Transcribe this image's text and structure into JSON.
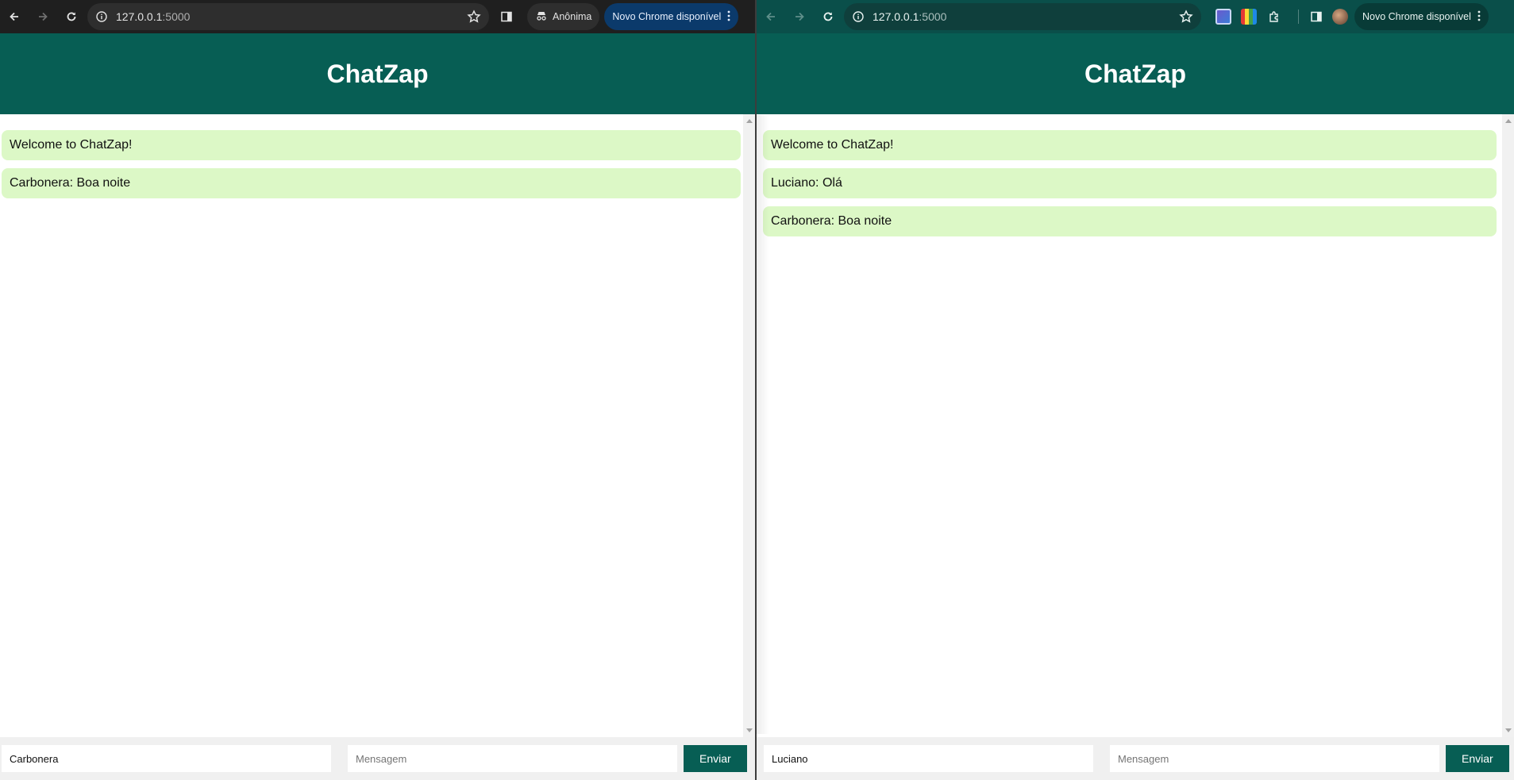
{
  "left": {
    "browser": {
      "url_host": "127.0.0.1",
      "url_port": ":5000",
      "incognito_label": "Anônima",
      "update_label": "Novo Chrome disponível"
    },
    "app": {
      "title": "ChatZap",
      "messages": [
        "Welcome to ChatZap!",
        "Carbonera: Boa noite"
      ],
      "username_value": "Carbonera",
      "message_placeholder": "Mensagem",
      "send_label": "Enviar"
    }
  },
  "right": {
    "browser": {
      "url_host": "127.0.0.1",
      "url_port": ":5000",
      "update_label": "Novo Chrome disponível"
    },
    "app": {
      "title": "ChatZap",
      "messages": [
        "Welcome to ChatZap!",
        "Luciano: Olá",
        "Carbonera: Boa noite"
      ],
      "username_value": "Luciano",
      "message_placeholder": "Mensagem",
      "send_label": "Enviar"
    }
  },
  "colors": {
    "header": "#075e54",
    "message_bubble": "#dcf8c6",
    "incognito_toolbar": "#1f1f1f",
    "profile_toolbar": "#0a4f4a"
  },
  "icons": [
    "back-icon",
    "forward-icon",
    "reload-icon",
    "site-info-icon",
    "star-icon",
    "side-panel-icon",
    "incognito-icon",
    "kebab-menu-icon",
    "extensions-icon"
  ]
}
